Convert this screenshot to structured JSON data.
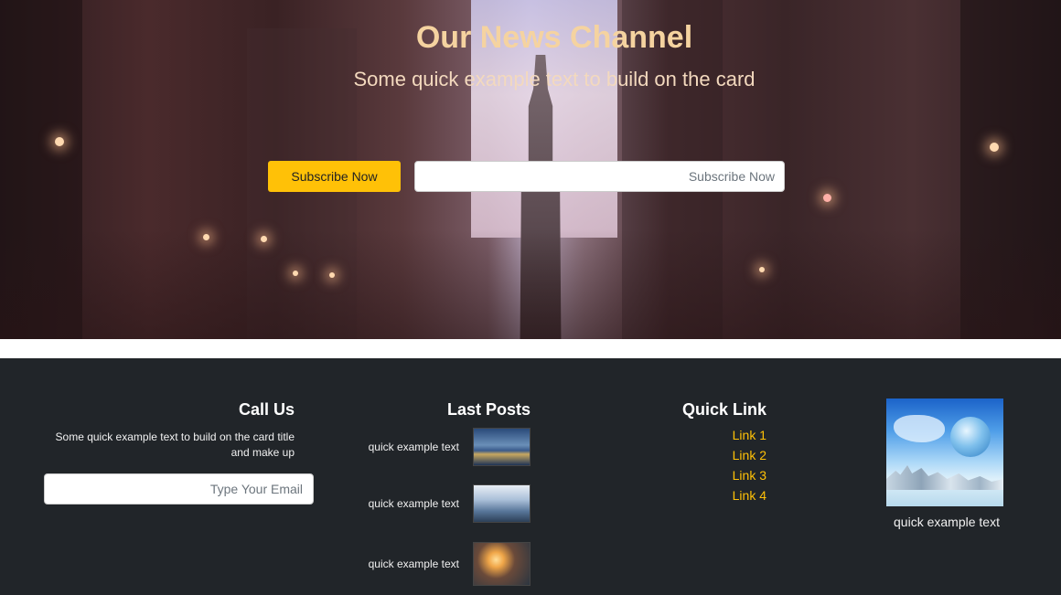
{
  "hero": {
    "title": "Our News Channel",
    "subtitle": "Some quick example text to build on the card",
    "subscribe_button_label": "Subscribe Now",
    "subscribe_input_placeholder": "Subscribe Now"
  },
  "footer": {
    "call_us": {
      "title": "Call Us",
      "text": "Some quick example text to build on the card title and make up",
      "email_placeholder": "Type Your Email"
    },
    "last_posts": {
      "title": "Last Posts",
      "items": [
        {
          "text": "quick example text",
          "image": "city-skyline-night-thumbnail"
        },
        {
          "text": "quick example text",
          "image": "city-skyscrapers-thumbnail"
        },
        {
          "text": "quick example text",
          "image": "lightbulb-thumbnail"
        }
      ]
    },
    "quick_link": {
      "title": "Quick Link",
      "links": [
        "Link 1",
        "Link 2",
        "Link 3",
        "Link 4"
      ]
    },
    "feature": {
      "image": "globe-city-image",
      "caption": "quick example text"
    }
  },
  "colors": {
    "accent": "#ffc107",
    "footer_bg": "#212529",
    "hero_title": "#f5d3a0"
  }
}
